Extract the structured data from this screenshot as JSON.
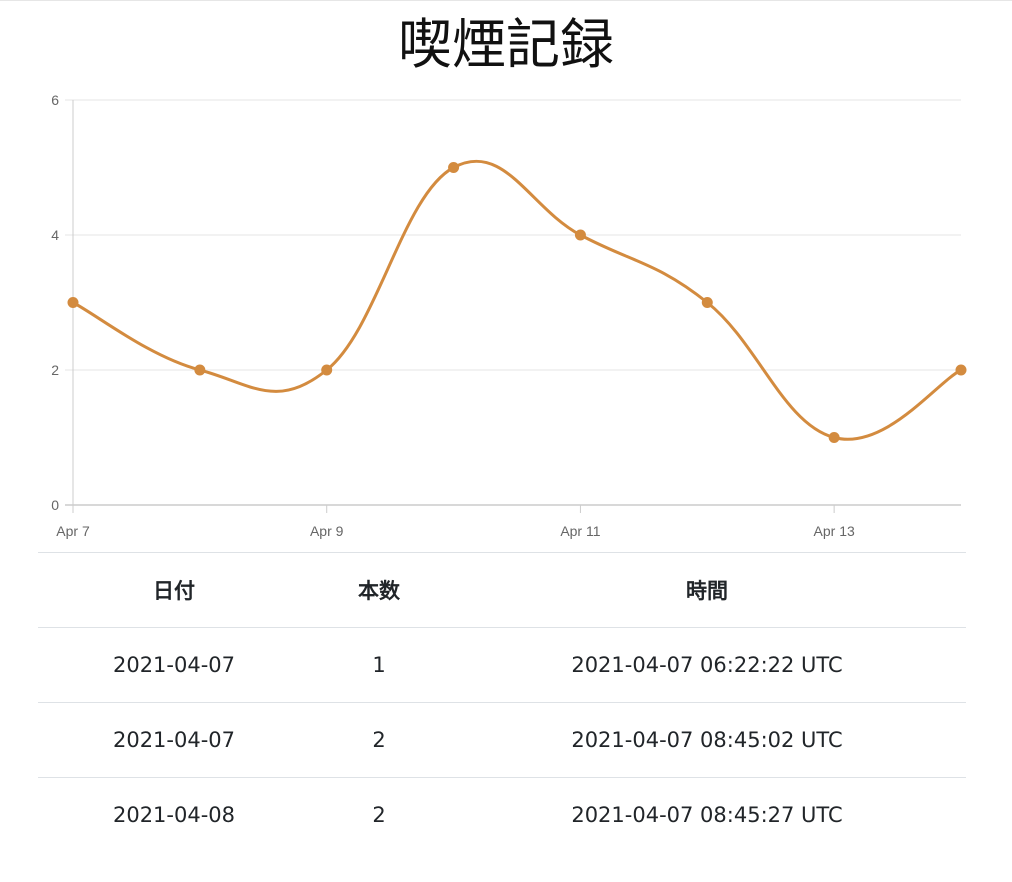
{
  "page": {
    "title": "喫煙記録"
  },
  "colors": {
    "line": "#d38b3f",
    "grid": "#e6e6e6",
    "axis": "#cccccc",
    "tick_text": "#666666"
  },
  "chart_data": {
    "type": "line",
    "title": "",
    "xlabel": "",
    "ylabel": "",
    "x": [
      "2021-04-07",
      "2021-04-08",
      "2021-04-09",
      "2021-04-10",
      "2021-04-11",
      "2021-04-12",
      "2021-04-13",
      "2021-04-14"
    ],
    "y": [
      3,
      2,
      2,
      5,
      4,
      3,
      1,
      2
    ],
    "x_ticks": [
      {
        "label": "Apr 7",
        "index": 0
      },
      {
        "label": "Apr 9",
        "index": 2
      },
      {
        "label": "Apr 11",
        "index": 4
      },
      {
        "label": "Apr 13",
        "index": 6
      }
    ],
    "y_ticks": [
      0,
      2,
      4,
      6
    ],
    "ylim": [
      0,
      6
    ],
    "grid": true,
    "smooth": true,
    "legend": "none"
  },
  "table": {
    "headers": {
      "date": "日付",
      "count": "本数",
      "time": "時間"
    },
    "rows": [
      {
        "date": "2021-04-07",
        "count": "1",
        "time": "2021-04-07 06:22:22 UTC"
      },
      {
        "date": "2021-04-07",
        "count": "2",
        "time": "2021-04-07 08:45:02 UTC"
      },
      {
        "date": "2021-04-08",
        "count": "2",
        "time": "2021-04-07 08:45:27 UTC"
      }
    ]
  }
}
